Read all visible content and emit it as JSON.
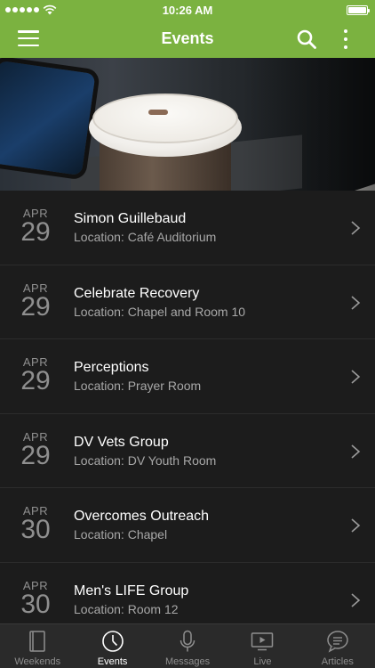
{
  "status_bar": {
    "time": "10:26 AM"
  },
  "nav": {
    "title": "Events",
    "menu_icon": "hamburger-menu-icon",
    "search_icon": "search-icon",
    "more_icon": "more-vertical-icon"
  },
  "events": [
    {
      "month": "APR",
      "day": "29",
      "title": "Simon Guillebaud",
      "location": "Location: Café Auditorium"
    },
    {
      "month": "APR",
      "day": "29",
      "title": "Celebrate Recovery",
      "location": "Location: Chapel and Room 10"
    },
    {
      "month": "APR",
      "day": "29",
      "title": "Perceptions",
      "location": "Location: Prayer Room"
    },
    {
      "month": "APR",
      "day": "29",
      "title": "DV Vets Group",
      "location": "Location: DV Youth Room"
    },
    {
      "month": "APR",
      "day": "30",
      "title": "Overcomes Outreach",
      "location": "Location: Chapel"
    },
    {
      "month": "APR",
      "day": "30",
      "title": "Men's LIFE Group",
      "location": "Location: Room 12"
    }
  ],
  "tabs": [
    {
      "label": "Weekends",
      "icon": "book-icon",
      "active": false
    },
    {
      "label": "Events",
      "icon": "clock-icon",
      "active": true
    },
    {
      "label": "Messages",
      "icon": "microphone-icon",
      "active": false
    },
    {
      "label": "Live",
      "icon": "tv-icon",
      "active": false
    },
    {
      "label": "Articles",
      "icon": "chat-bubble-icon",
      "active": false
    }
  ],
  "colors": {
    "accent": "#7bb240",
    "background": "#1c1c1c",
    "tab_bar": "#2a2a2a"
  }
}
